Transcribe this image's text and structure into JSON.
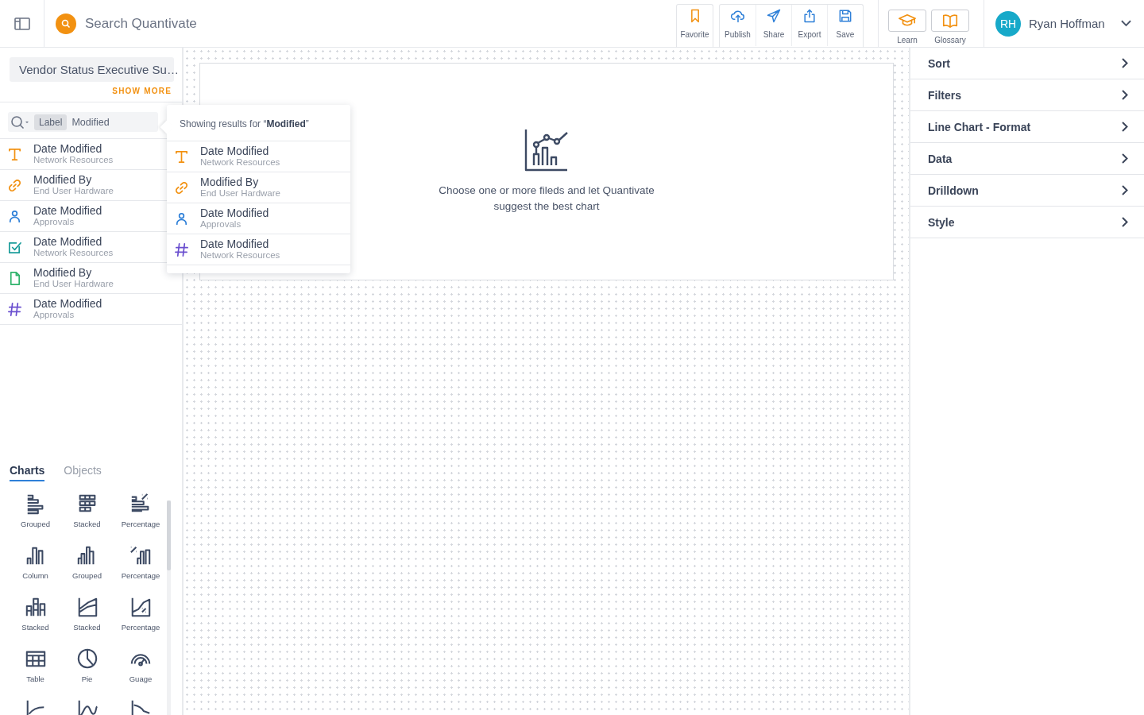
{
  "search": {
    "placeholder": "Search Quantivate"
  },
  "toolbar_groups": [
    [
      {
        "kind": "bookmark",
        "label": "Favorite"
      }
    ],
    [
      {
        "kind": "upload-cloud",
        "label": "Publish"
      },
      {
        "kind": "send",
        "label": "Share"
      },
      {
        "kind": "export",
        "label": "Export"
      },
      {
        "kind": "save",
        "label": "Save"
      }
    ]
  ],
  "help_buttons": [
    {
      "kind": "cap",
      "label": "Learn"
    },
    {
      "kind": "book",
      "label": "Glossary"
    }
  ],
  "user": {
    "initials": "RH",
    "name": "Ryan Hoffman"
  },
  "report": {
    "title": "Vendor Status Executive Su…",
    "show_more": "SHOW MORE"
  },
  "field_search": {
    "chip": "Label",
    "value": "Modified"
  },
  "fields": [
    {
      "kind": "text",
      "name": "Date Modified",
      "source": "Network Resources"
    },
    {
      "kind": "link",
      "name": "Modified By",
      "source": "End User Hardware"
    },
    {
      "kind": "person",
      "name": "Date Modified",
      "source": "Approvals"
    },
    {
      "kind": "checkbox",
      "name": "Date Modified",
      "source": "Network Resources"
    },
    {
      "kind": "document",
      "name": "Modified By",
      "source": "End User Hardware"
    },
    {
      "kind": "number",
      "name": "Date Modified",
      "source": "Approvals"
    }
  ],
  "popup": {
    "heading": "Showing results for “**Modified**”",
    "results": [
      {
        "kind": "text",
        "name": "Date Modified",
        "source": "Network Resources"
      },
      {
        "kind": "link",
        "name": "Modified By",
        "source": "End User Hardware"
      },
      {
        "kind": "person",
        "name": "Date Modified",
        "source": "Approvals"
      },
      {
        "kind": "number",
        "name": "Date Modified",
        "source": "Network Resources"
      }
    ]
  },
  "panel_tabs": [
    {
      "label": "Charts",
      "selected": true
    },
    {
      "label": "Objects",
      "selected": false
    }
  ],
  "chart_types": [
    {
      "kind": "hbar-grouped",
      "label": "Grouped"
    },
    {
      "kind": "hbar-stacked",
      "label": "Stacked"
    },
    {
      "kind": "hbar-percent",
      "label": "Percentage"
    },
    {
      "kind": "column",
      "label": "Column"
    },
    {
      "kind": "column-grouped",
      "label": "Grouped"
    },
    {
      "kind": "column-percent",
      "label": "Percentage"
    },
    {
      "kind": "column-stacked",
      "label": "Stacked"
    },
    {
      "kind": "area-stacked",
      "label": "Stacked"
    },
    {
      "kind": "area-percent",
      "label": "Percentage"
    },
    {
      "kind": "table",
      "label": "Table"
    },
    {
      "kind": "pie",
      "label": "Pie"
    },
    {
      "kind": "gauge",
      "label": "Guage"
    },
    {
      "kind": "line"
    },
    {
      "kind": "spline"
    },
    {
      "kind": "falling-line"
    }
  ],
  "canvas": {
    "message": "Choose one or more fileds and let Quantivate suggest the best chart"
  },
  "properties": [
    "Sort",
    "Filters",
    "Line Chart - Format",
    "Data",
    "Drilldown",
    "Style"
  ]
}
